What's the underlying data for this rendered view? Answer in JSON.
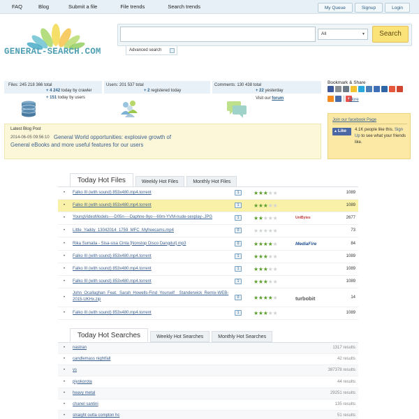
{
  "nav": {
    "items": [
      "FAQ",
      "Blog",
      "Submit a file",
      "File trends",
      "Search trends"
    ],
    "right": [
      "My Queue",
      "Signup",
      "Login"
    ]
  },
  "logo": {
    "text": "GENERAL-SEARCH.COM"
  },
  "search": {
    "query": "",
    "category": "All",
    "button": "Search",
    "advanced": "Advanced search"
  },
  "stats": {
    "files": {
      "label": "Files:",
      "total": "245 218 366",
      "total_word": "total",
      "crawler_count": "+ 4 242",
      "crawler_text": "today by crawler",
      "users_count": "+ 151",
      "users_text": "today by users"
    },
    "users": {
      "label": "Users:",
      "total": "201 537",
      "total_word": "total",
      "registered_count": "+ 2",
      "registered_text": "registered today"
    },
    "comments": {
      "label": "Comments:",
      "total": "130 438",
      "total_word": "total",
      "yesterday_count": "+ 22",
      "yesterday_text": "yesterday",
      "visit_text": "Visit our",
      "forum": "forum"
    }
  },
  "bookmark": {
    "title": "Bookmark & Share",
    "more": "More"
  },
  "facebook": {
    "title": "Join our facebook Page",
    "like": "Like",
    "text_before": "4.1K people like this.",
    "sign_up": "Sign Up",
    "text_after": "to see what your friends like."
  },
  "blog": {
    "label": "Latest Blog Post",
    "date": "2014-06-05 09:56:10",
    "link": "General World opportunities: explosive growth of General eBooks and more useful features for our users"
  },
  "file_tabs": [
    "Today Hot Files",
    "Weekly Hot Files",
    "Monthly Hot Files"
  ],
  "files": [
    {
      "name": "Falko III (with sound) 853x480.mp4.torrent",
      "comments": "1",
      "rating": 3,
      "host": "",
      "count": "1089",
      "highlight": false
    },
    {
      "name": "Falko III (with sound) 853x480.mp4.torrent",
      "comments": "1",
      "rating": 3,
      "host": "",
      "count": "1089",
      "highlight": true
    },
    {
      "name": "YoungVideoModels----D05n----Daphne-9yo---60m-YVM-nude-sexplay-.JPG",
      "comments": "1",
      "rating": 2,
      "host": "UniBytes",
      "count": "2677",
      "highlight": false
    },
    {
      "name": "Little_Yaddy_13042014_1759_MFC_Myfreecams.mp4",
      "comments": "0",
      "rating": 0,
      "host": "",
      "count": "73",
      "highlight": false
    },
    {
      "name": "Rika Sumalia - Sisa-sisa Cinta [Nonstop Disco Dangdut].mp3",
      "comments": "0",
      "rating": 4,
      "host": "MediaFire",
      "count": "84",
      "highlight": false
    },
    {
      "name": "Falko III (with sound) 853x480.mp4.torrent",
      "comments": "1",
      "rating": 3,
      "host": "",
      "count": "1089",
      "highlight": false
    },
    {
      "name": "Falko III (with sound) 853x480.mp4.torrent",
      "comments": "1",
      "rating": 3,
      "host": "",
      "count": "1089",
      "highlight": false
    },
    {
      "name": "Falko III (with sound) 853x480.mp4.torrent",
      "comments": "1",
      "rating": 3,
      "host": "",
      "count": "1089",
      "highlight": false
    },
    {
      "name": "John_Ocallaghan_Feat._Sarah_Howells-Find_Yourself__Standerwick_Remix-WEB-2015-UKHx.zip",
      "comments": "0",
      "rating": 4,
      "host": "turbobit",
      "count": "14",
      "highlight": false
    },
    {
      "name": "Falko III (with sound) 853x480.mp4.torrent",
      "comments": "1",
      "rating": 3,
      "host": "",
      "count": "1089",
      "highlight": false
    }
  ],
  "search_tabs": [
    "Today Hot Searches",
    "Weekly Hot Searches",
    "Monthly Hot Searches"
  ],
  "searches": [
    {
      "query": "nastran",
      "results": "1317 results"
    },
    {
      "query": "candlemass nightfall",
      "results": "42 results"
    },
    {
      "query": "vs",
      "results": "387378 results"
    },
    {
      "query": "piyokorota",
      "results": "44 results"
    },
    {
      "query": "heavy metal",
      "results": "29251 results"
    },
    {
      "query": "chanel santini",
      "results": "135 results"
    },
    {
      "query": "straight outta compton hc",
      "results": "51 results"
    }
  ],
  "colors": {
    "link": "#3b5f8e",
    "star_on": "#5b9e2c",
    "star_off": "#cfd3d6",
    "highlight": "#faf1a8",
    "search_button": "#fbe37a"
  }
}
